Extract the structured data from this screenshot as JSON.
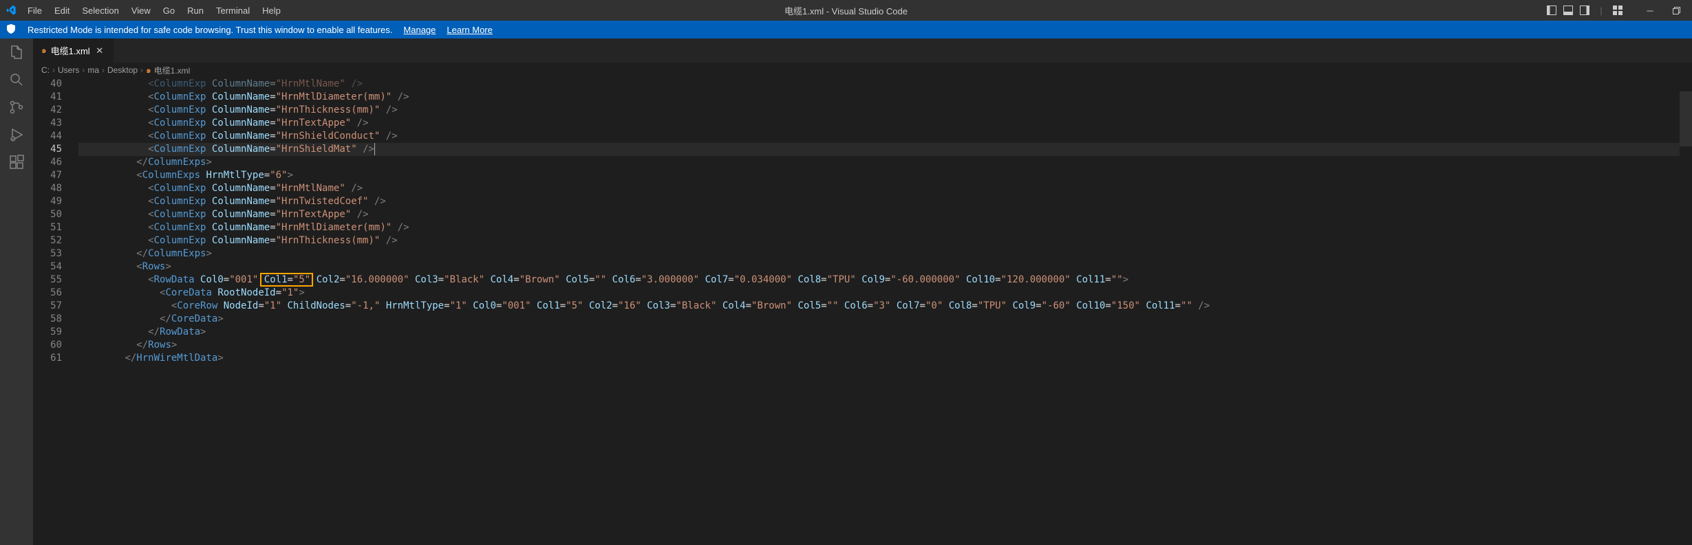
{
  "title": "电缆1.xml - Visual Studio Code",
  "menu": [
    "File",
    "Edit",
    "Selection",
    "View",
    "Go",
    "Run",
    "Terminal",
    "Help"
  ],
  "banner": {
    "text": "Restricted Mode is intended for safe code browsing. Trust this window to enable all features.",
    "manage": "Manage",
    "learn": "Learn More"
  },
  "tab": {
    "name": "电缆1.xml"
  },
  "breadcrumb": [
    "C:",
    "Users",
    "ma",
    "Desktop",
    "电缆1.xml"
  ],
  "lines": {
    "start": 40,
    "active": 45,
    "rows": [
      {
        "n": 40,
        "indent": 12,
        "type": "colexp",
        "attr": "ColumnName",
        "val": "HrnMtlName",
        "dim": true
      },
      {
        "n": 41,
        "indent": 12,
        "type": "colexp",
        "attr": "ColumnName",
        "val": "HrnMtlDiameter(mm)"
      },
      {
        "n": 42,
        "indent": 12,
        "type": "colexp",
        "attr": "ColumnName",
        "val": "HrnThickness(mm)"
      },
      {
        "n": 43,
        "indent": 12,
        "type": "colexp",
        "attr": "ColumnName",
        "val": "HrnTextAppe"
      },
      {
        "n": 44,
        "indent": 12,
        "type": "colexp",
        "attr": "ColumnName",
        "val": "HrnShieldConduct"
      },
      {
        "n": 45,
        "indent": 12,
        "type": "colexp",
        "attr": "ColumnName",
        "val": "HrnShieldMat",
        "cursor": true
      },
      {
        "n": 46,
        "indent": 10,
        "type": "close",
        "name": "ColumnExps"
      },
      {
        "n": 47,
        "indent": 10,
        "type": "open",
        "name": "ColumnExps",
        "attrs": [
          [
            "HrnMtlType",
            "6"
          ]
        ]
      },
      {
        "n": 48,
        "indent": 12,
        "type": "colexp",
        "attr": "ColumnName",
        "val": "HrnMtlName"
      },
      {
        "n": 49,
        "indent": 12,
        "type": "colexp",
        "attr": "ColumnName",
        "val": "HrnTwistedCoef"
      },
      {
        "n": 50,
        "indent": 12,
        "type": "colexp",
        "attr": "ColumnName",
        "val": "HrnTextAppe"
      },
      {
        "n": 51,
        "indent": 12,
        "type": "colexp",
        "attr": "ColumnName",
        "val": "HrnMtlDiameter(mm)"
      },
      {
        "n": 52,
        "indent": 12,
        "type": "colexp",
        "attr": "ColumnName",
        "val": "HrnThickness(mm)"
      },
      {
        "n": 53,
        "indent": 10,
        "type": "close",
        "name": "ColumnExps"
      },
      {
        "n": 54,
        "indent": 10,
        "type": "open",
        "name": "Rows",
        "attrs": []
      },
      {
        "n": 55,
        "indent": 12,
        "type": "open",
        "name": "RowData",
        "attrs": [
          [
            "Col0",
            "001"
          ],
          [
            "Col1",
            "5"
          ],
          [
            "Col2",
            "16.000000"
          ],
          [
            "Col3",
            "Black"
          ],
          [
            "Col4",
            "Brown"
          ],
          [
            "Col5",
            ""
          ],
          [
            "Col6",
            "3.000000"
          ],
          [
            "Col7",
            "0.034000"
          ],
          [
            "Col8",
            "TPU"
          ],
          [
            "Col9",
            "-60.000000"
          ],
          [
            "Col10",
            "120.000000"
          ],
          [
            "Col11",
            ""
          ]
        ]
      },
      {
        "n": 56,
        "indent": 14,
        "type": "open",
        "name": "CoreData",
        "attrs": [
          [
            "RootNodeId",
            "1"
          ]
        ]
      },
      {
        "n": 57,
        "indent": 16,
        "type": "self",
        "name": "CoreRow",
        "attrs": [
          [
            "NodeId",
            "1"
          ],
          [
            "ChildNodes",
            "-1,"
          ],
          [
            "HrnMtlType",
            "1"
          ],
          [
            "Col0",
            "001"
          ],
          [
            "Col1",
            "5"
          ],
          [
            "Col2",
            "16"
          ],
          [
            "Col3",
            "Black"
          ],
          [
            "Col4",
            "Brown"
          ],
          [
            "Col5",
            ""
          ],
          [
            "Col6",
            "3"
          ],
          [
            "Col7",
            "0"
          ],
          [
            "Col8",
            "TPU"
          ],
          [
            "Col9",
            "-60"
          ],
          [
            "Col10",
            "150"
          ],
          [
            "Col11",
            ""
          ]
        ]
      },
      {
        "n": 58,
        "indent": 14,
        "type": "close",
        "name": "CoreData"
      },
      {
        "n": 59,
        "indent": 12,
        "type": "close",
        "name": "RowData"
      },
      {
        "n": 60,
        "indent": 10,
        "type": "close",
        "name": "Rows"
      },
      {
        "n": 61,
        "indent": 8,
        "type": "close",
        "name": "HrnWireMtlData"
      }
    ]
  },
  "highlight": {
    "line": 55,
    "attr_index": 1
  }
}
